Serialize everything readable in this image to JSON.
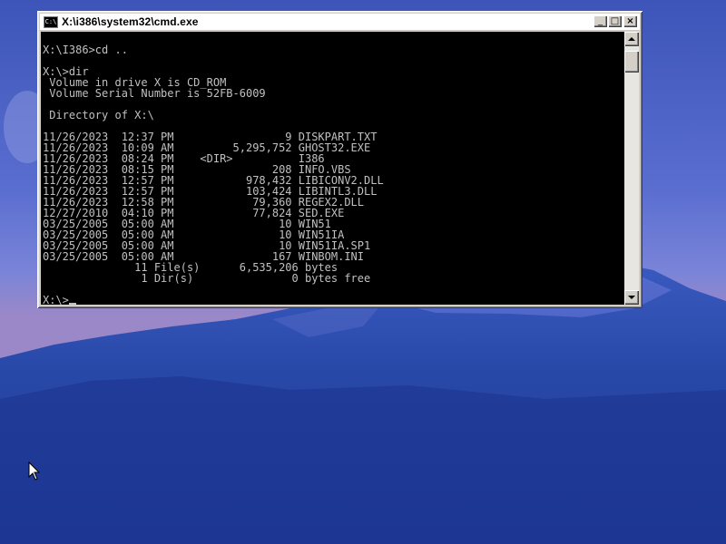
{
  "window": {
    "title": "X:\\i386\\system32\\cmd.exe",
    "icon_label": "C:\\",
    "buttons": {
      "minimize": "_",
      "maximize": "□",
      "close": "×"
    }
  },
  "console": {
    "lines": [
      "",
      "X:\\I386>cd ..",
      "",
      "X:\\>dir",
      " Volume in drive X is CD_ROM",
      " Volume Serial Number is 52FB-6009",
      "",
      " Directory of X:\\",
      "",
      "11/26/2023  12:37 PM                 9 DISKPART.TXT",
      "11/26/2023  10:09 AM         5,295,752 GHOST32.EXE",
      "11/26/2023  08:24 PM    <DIR>          I386",
      "11/26/2023  08:15 PM               208 INFO.VBS",
      "11/26/2023  12:57 PM           978,432 LIBICONV2.DLL",
      "11/26/2023  12:57 PM           103,424 LIBINTL3.DLL",
      "11/26/2023  12:58 PM            79,360 REGEX2.DLL",
      "12/27/2010  04:10 PM            77,824 SED.EXE",
      "03/25/2005  05:00 AM                10 WIN51",
      "03/25/2005  05:00 AM                10 WIN51IA",
      "03/25/2005  05:00 AM                10 WIN51IA.SP1",
      "03/25/2005  05:00 AM               167 WINBOM.INI",
      "              11 File(s)      6,535,206 bytes",
      "               1 Dir(s)               0 bytes free",
      ""
    ],
    "prompt": "X:\\>",
    "text_color": "#c0c0c0",
    "background_color": "#000000"
  },
  "icons": {
    "window_icon": "cmd-window-icon",
    "scroll_up": "scroll-up-arrow-icon",
    "scroll_down": "scroll-down-arrow-icon",
    "pointer": "mouse-pointer-icon"
  }
}
